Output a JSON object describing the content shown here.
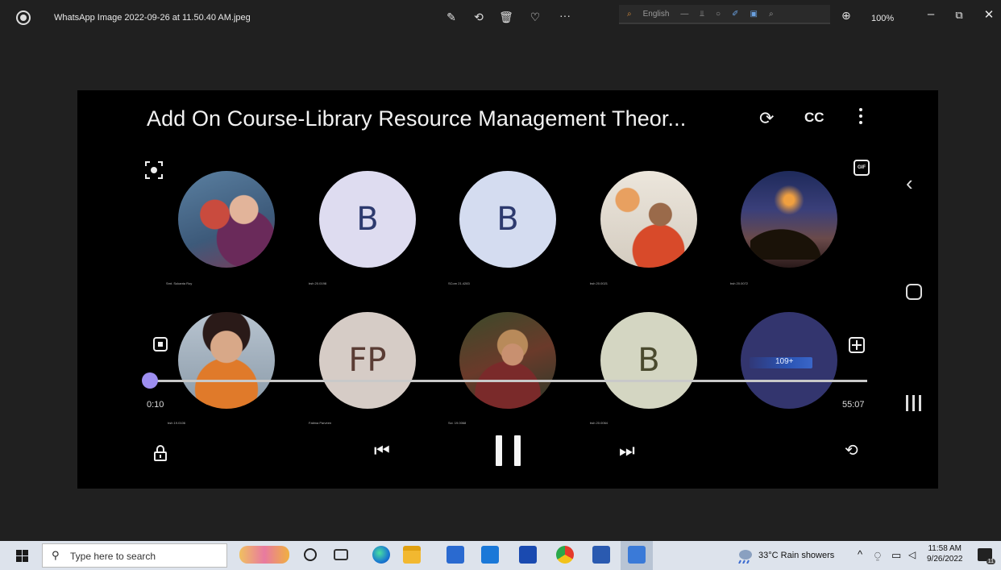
{
  "titlebar": {
    "file_name": "WhatsApp Image 2022-09-26 at 11.50.40 AM.jpeg",
    "zoom": "100%",
    "overlay_lang_label": "English"
  },
  "video": {
    "title": "Add On Course-Library Resource Management Theor...",
    "cc_label": "CC",
    "gif_label": "GIF",
    "time_current": "0:10",
    "time_total": "55:07",
    "progress_fraction": 0.003,
    "tiles": [
      {
        "initial": "",
        "name": "Smt. Sukanta Roy"
      },
      {
        "initial": "B",
        "name": "bsh 20.0198"
      },
      {
        "initial": "B",
        "name": "SCom 21.4283"
      },
      {
        "initial": "",
        "name": "bsh 20.0021"
      },
      {
        "initial": "",
        "name": "bsh 20.0072"
      },
      {
        "initial": "",
        "name": "bsh 19.0106"
      },
      {
        "initial": "FP",
        "name": "Fatima Parveen"
      },
      {
        "initial": "",
        "name": "Sci. 19.0068"
      },
      {
        "initial": "B",
        "name": "bsh 20.0064"
      },
      {
        "initial": "",
        "name": ""
      }
    ],
    "rec_label": "109+"
  },
  "taskbar": {
    "search_placeholder": "Type here to search",
    "weather": "33°C  Rain showers",
    "time": "11:58 AM",
    "date": "9/26/2022",
    "notification_count": "11"
  }
}
